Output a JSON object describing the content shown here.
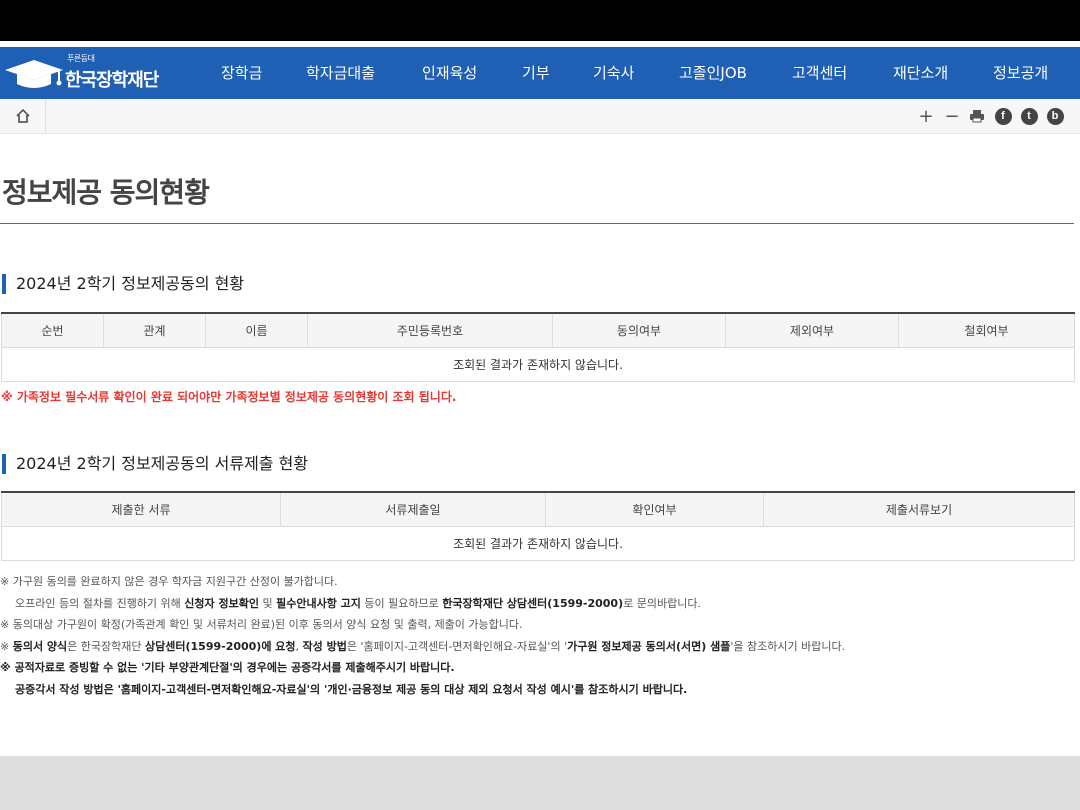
{
  "header": {
    "slogan": "푸른등대",
    "logo_name": "한국장학재단",
    "menu": [
      "장학금",
      "학자금대출",
      "인재육성",
      "기부",
      "기숙사",
      "고졸인JOB",
      "고객센터",
      "재단소개",
      "정보공개"
    ]
  },
  "toolbar": {
    "zoom_in": "+",
    "zoom_out": "−",
    "facebook": "f",
    "twitter": "t",
    "blog": "b"
  },
  "page": {
    "title": "정보제공 동의현황"
  },
  "section1": {
    "title": "2024년 2학기 정보제공동의 현황",
    "columns": [
      "순번",
      "관계",
      "이름",
      "주민등록번호",
      "동의여부",
      "제외여부",
      "철회여부"
    ],
    "empty_message": "조회된 결과가 존재하지 않습니다.",
    "warning": "※ 가족정보 필수서류 확인이 완료 되어야만 가족정보별 정보제공 동의현황이 조회 됩니다."
  },
  "section2": {
    "title": "2024년 2학기 정보제공동의 서류제출 현황",
    "columns": [
      "제출한 서류",
      "서류제출일",
      "확인여부",
      "제출서류보기"
    ],
    "empty_message": "조회된 결과가 존재하지 않습니다."
  },
  "notes": {
    "n1": "※ 가구원 동의를 완료하지 않은 경우 학자금 지원구간 산정이 불가합니다.",
    "n2_a": "오프라인 등의 절차를 진행하기 위해 ",
    "n2_b": "신청자 정보확인",
    "n2_c": " 및 ",
    "n2_d": "필수안내사항 고지",
    "n2_e": " 등이 필요하므로 ",
    "n2_f": "한국장학재단 상담센터(1599-2000)",
    "n2_g": "로 문의바랍니다.",
    "n3": "※ 동의대상 가구원이 확정(가족관계 확인 및 서류처리 완료)된 이후 동의서 양식 요청 및 출력, 제출이 가능합니다.",
    "n4_a": "※ ",
    "n4_b": "동의서 양식",
    "n4_c": "은 한국장학재단 ",
    "n4_d": "상담센터(1599-2000)에 요청",
    "n4_e": ", ",
    "n4_f": "작성 방법",
    "n4_g": "은 '홈페이지-고객센터-면저확인해요-자료실'의 '",
    "n4_h": "가구원 정보제공 동의서(서면) 샘플",
    "n4_i": "'을 참조하시기 바랍니다.",
    "n5": "※ 공적자료로 증빙할 수 없는 '기타 부양관계단절'의 경우에는 공증각서를 제출해주시기 바랍니다.",
    "n6": "공증각서 작성 방법은 '홈페이지-고객센터-면저확인해요-자료실'의 '개인·금융정보 제공 동의 대상 제외 요청서 작성 예시'를 참조하시기 바랍니다."
  }
}
